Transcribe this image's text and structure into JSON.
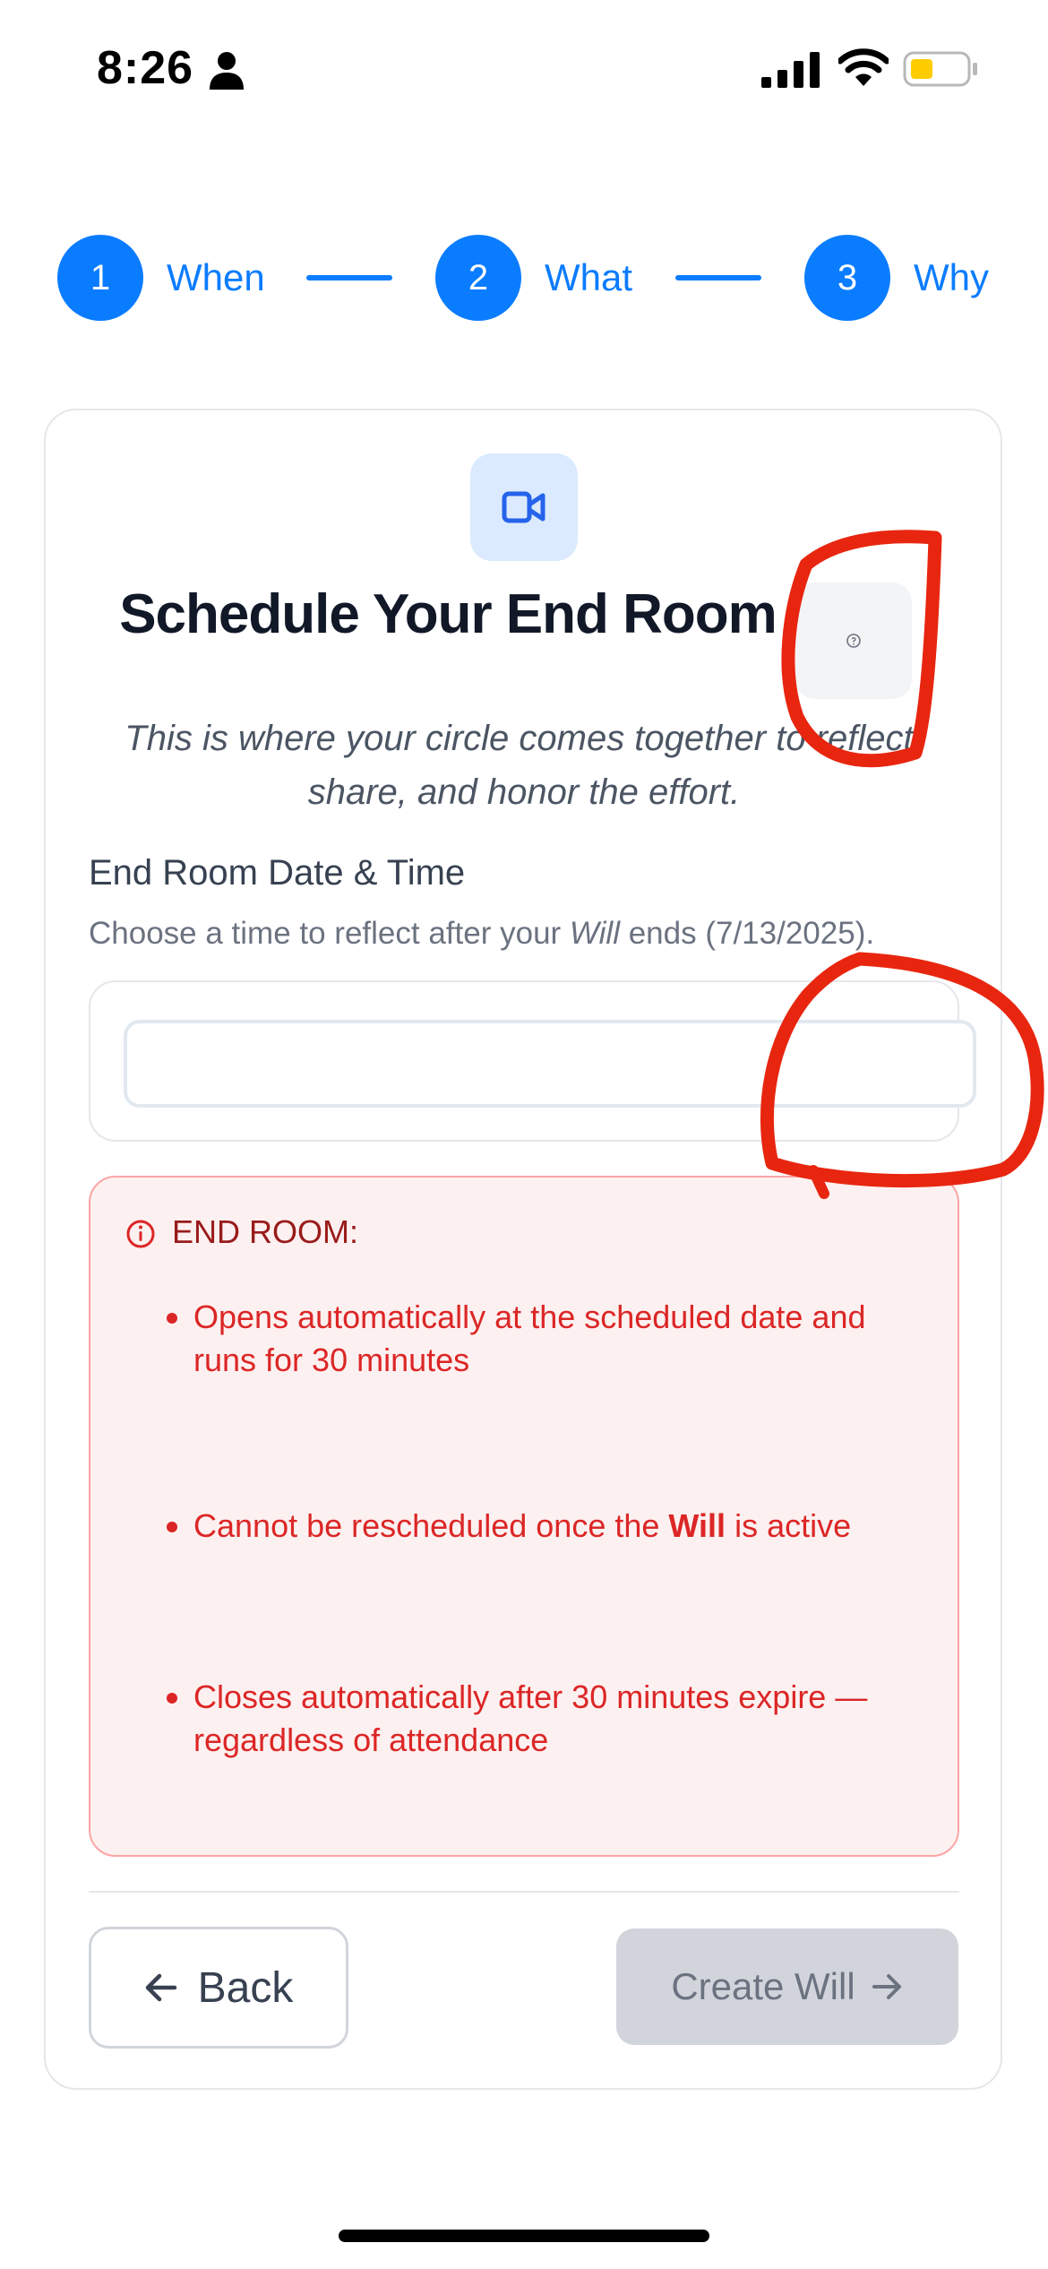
{
  "status_bar": {
    "time": "8:26"
  },
  "stepper": {
    "steps": [
      {
        "number": "1",
        "label": "When"
      },
      {
        "number": "2",
        "label": "What"
      },
      {
        "number": "3",
        "label": "Why"
      }
    ]
  },
  "card": {
    "header_icon": "video-icon",
    "title": "Schedule Your End Room",
    "help_icon": "question-circle-icon",
    "subtitle": "This is where your circle comes together to reflect, share, and honor the effort.",
    "field": {
      "label": "End Room Date & Time",
      "hint_prefix": "Choose a time to reflect after your ",
      "hint_emph": "Will",
      "hint_suffix": " ends (7/13/2025).",
      "value": ""
    },
    "info": {
      "icon": "info-circle-icon",
      "title": "END ROOM:",
      "bullets": [
        {
          "text": "Opens automatically at the scheduled date and runs for 30 minutes"
        },
        {
          "prefix": "Cannot be rescheduled once the ",
          "bold": "Will",
          "suffix": " is active"
        },
        {
          "text": "Closes automatically after 30 minutes expire — regardless of attendance"
        }
      ]
    },
    "back_button": {
      "label": "Back",
      "icon": "arrow-left-icon"
    },
    "create_button": {
      "label": "Create Will",
      "icon": "arrow-right-icon",
      "enabled": false
    }
  },
  "colors": {
    "accent": "#0a7cff",
    "info_text": "#dc2626",
    "info_bg": "#fdf0f0",
    "annotation": "#e8260f"
  }
}
